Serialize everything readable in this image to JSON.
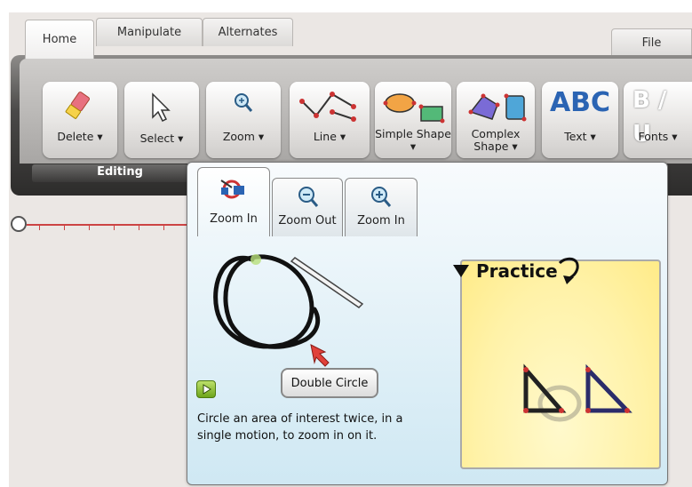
{
  "tabs": {
    "home": "Home",
    "manipulate": "Manipulate",
    "alternates": "Alternates",
    "file": "File"
  },
  "ribbon": {
    "buttons": [
      {
        "label": "Delete ▾",
        "icon": "eraser-icon"
      },
      {
        "label": "Select ▾",
        "icon": "cursor-icon"
      },
      {
        "label": "Zoom ▾",
        "icon": "magnifier-icon"
      },
      {
        "label": "Line ▾",
        "icon": "line-icon"
      },
      {
        "label": "Simple Shape ▾",
        "icon": "simple-shape-icon"
      },
      {
        "label": "Complex Shape ▾",
        "icon": "complex-shape-icon"
      },
      {
        "label": "Text ▾",
        "icon": "abc-text-icon",
        "glyph": "ABC"
      },
      {
        "label": "Fonts ▾",
        "icon": "fonts-icon",
        "glyph": "B / U"
      }
    ],
    "group_label": "Editing"
  },
  "popup": {
    "tabs": [
      {
        "label": "Zoom In",
        "icon": "zoom-in-gesture-icon"
      },
      {
        "label": "Zoom Out",
        "icon": "zoom-out-icon"
      },
      {
        "label": "Zoom In",
        "icon": "zoom-in-icon"
      }
    ],
    "gesture_button": "Double Circle",
    "description": "Circle an area of interest twice, in a single motion, to zoom in on it.",
    "practice_title": "Practice"
  }
}
